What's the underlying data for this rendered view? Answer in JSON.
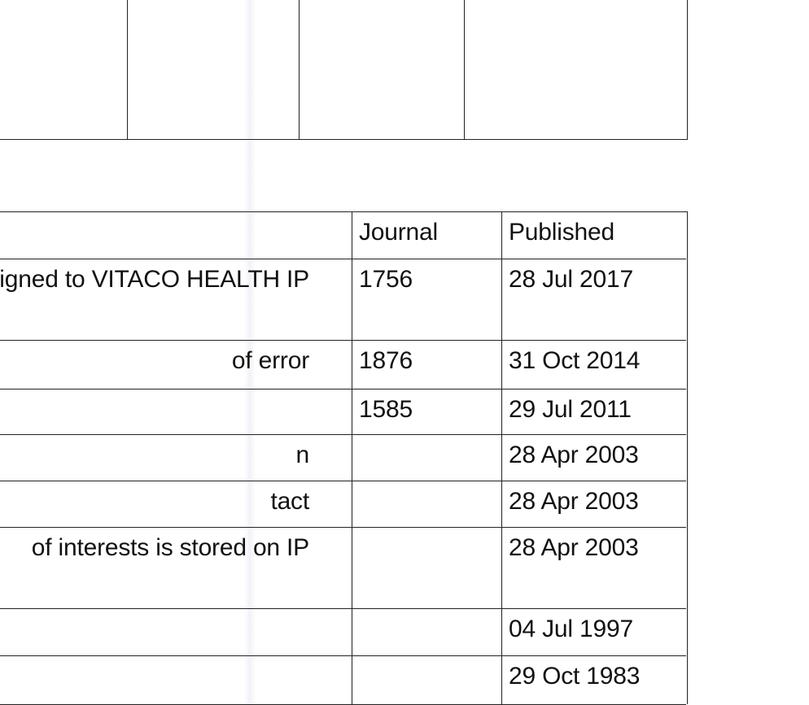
{
  "table": {
    "headers": [
      "",
      "Journal",
      "Published"
    ],
    "rows": [
      {
        "event": "igned to VITACO HEALTH IP",
        "journal": "1756",
        "published": "28 Jul 2017"
      },
      {
        "event": "of error",
        "journal": "1876",
        "published": "31 Oct 2014"
      },
      {
        "event": "",
        "journal": "1585",
        "published": "29 Jul 2011"
      },
      {
        "event": "n",
        "journal": "",
        "published": "28 Apr 2003"
      },
      {
        "event": "tact",
        "journal": "",
        "published": "28 Apr 2003"
      },
      {
        "event": "of interests is stored on IP",
        "journal": "",
        "published": "28 Apr 2003"
      },
      {
        "event": "",
        "journal": "",
        "published": "04 Jul 1997"
      },
      {
        "event": "",
        "journal": "",
        "published": "29 Oct 1983"
      }
    ]
  }
}
